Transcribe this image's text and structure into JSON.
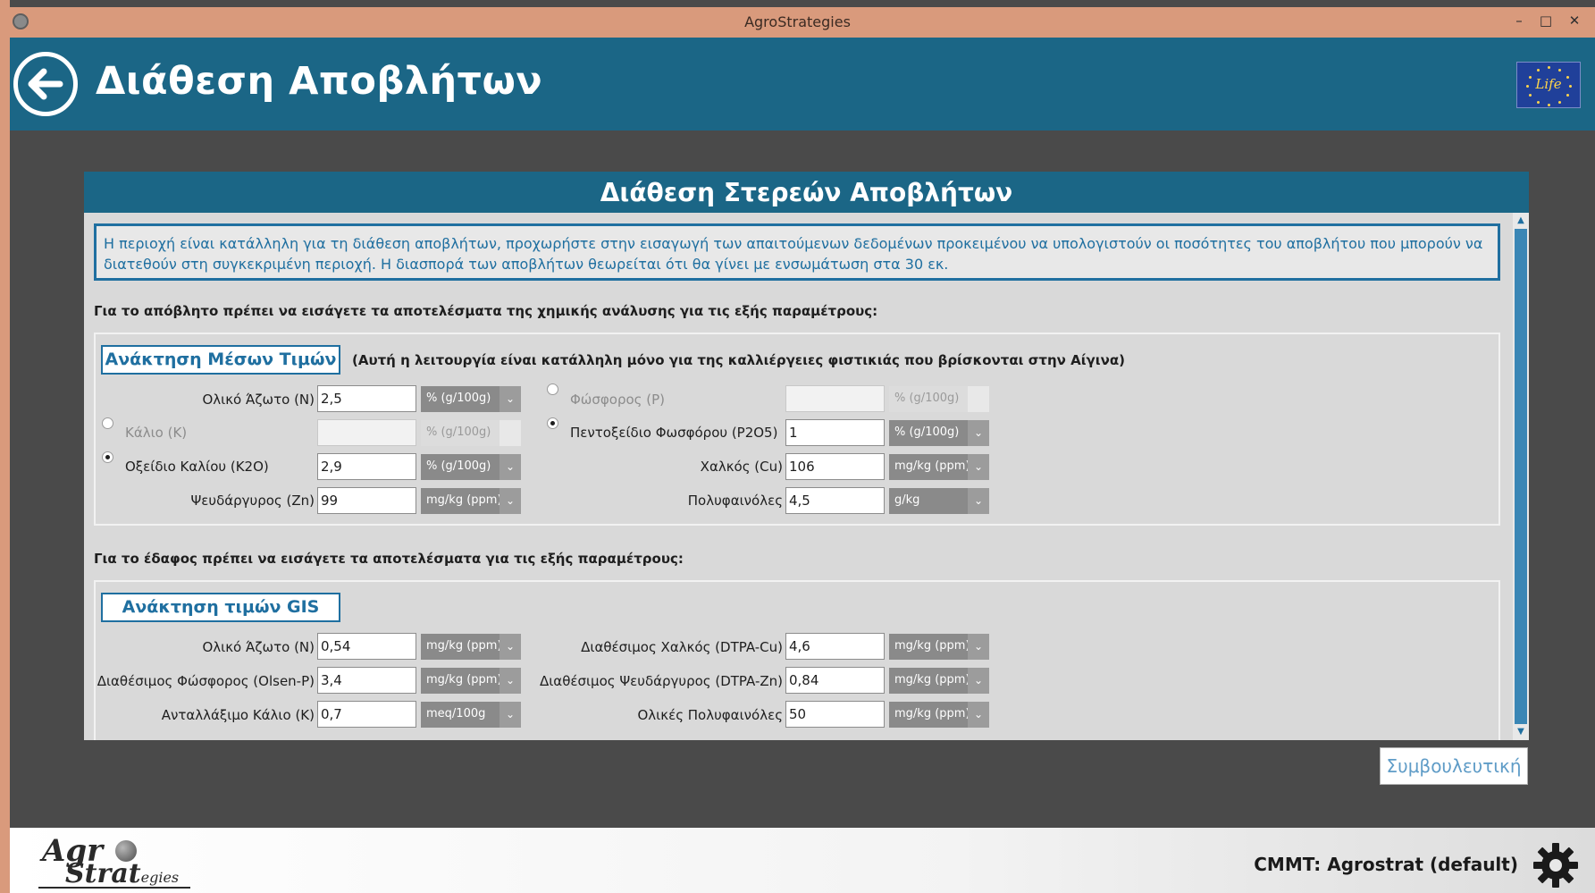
{
  "window": {
    "title": "AgroStrategies",
    "min_label": "–",
    "max_label": "□",
    "close_label": "✕"
  },
  "header": {
    "title": "Διάθεση Αποβλήτων",
    "eu_logo_text": "Life"
  },
  "card": {
    "title": "Διάθεση Στερεών Αποβλήτων",
    "info": "Η περιοχή είναι κατάλληλη για τη διάθεση αποβλήτων, προχωρήστε στην εισαγωγή των απαιτούμενων δεδομένων προκειμένου να υπολογιστούν οι ποσότητες του αποβλήτου που μπορούν να διατεθούν στη συγκεκριμένη περιοχή. Η διασπορά των αποβλήτων θεωρείται ότι θα γίνει με ενσωμάτωση στα 30 εκ.",
    "waste_section_label": "Για το απόβλητο πρέπει να εισάγετε τα αποτελέσματα της χημικής ανάλυσης για τις εξής παραμέτρους:",
    "soil_section_label": "Για το έδαφος πρέπει να εισάγετε τα αποτελέσματα για τις εξής παραμέτρους:"
  },
  "waste": {
    "fetch_button": "Ανάκτηση Μέσων Τιμών",
    "note": "(Αυτή η λειτουργία είναι κατάλληλη μόνο για της καλλιέργειες φιστικιάς που βρίσκονται στην Αίγινα)",
    "total_n": {
      "label": "Ολικό Άζωτο (N)",
      "value": "2,5",
      "unit": "% (g/100g)"
    },
    "potassium": {
      "label": "Κάλιο (K)",
      "value": "",
      "unit": "% (g/100g)",
      "selected": false
    },
    "k2o": {
      "label": "Οξείδιο Καλίου (K2O)",
      "value": "2,9",
      "unit": "% (g/100g)",
      "selected": true
    },
    "zinc": {
      "label": "Ψευδάργυρος (Zn)",
      "value": "99",
      "unit": "mg/kg (ppm)"
    },
    "phosphorus": {
      "label": "Φώσφορος (P)",
      "value": "",
      "unit": "% (g/100g)",
      "selected": false
    },
    "p2o5": {
      "label": "Πεντοξείδιο Φωσφόρου (P2O5)",
      "value": "1",
      "unit": "% (g/100g)",
      "selected": true
    },
    "copper": {
      "label": "Χαλκός (Cu)",
      "value": "106",
      "unit": "mg/kg (ppm)"
    },
    "polyphenols": {
      "label": "Πολυφαινόλες",
      "value": "4,5",
      "unit": "g/kg"
    }
  },
  "soil": {
    "fetch_button": "Ανάκτηση τιμών GIS",
    "total_n": {
      "label": "Ολικό Άζωτο (N)",
      "value": "0,54",
      "unit": "mg/kg (ppm)"
    },
    "olsen_p": {
      "label": "Διαθέσιμος Φώσφορος (Olsen-P)",
      "value": "3,4",
      "unit": "mg/kg (ppm)"
    },
    "exch_k": {
      "label": "Ανταλλάξιμο Κάλιο (K)",
      "value": "0,7",
      "unit": "meq/100g"
    },
    "dtpa_cu": {
      "label": "Διαθέσιμος Χαλκός (DTPA-Cu)",
      "value": "4,6",
      "unit": "mg/kg (ppm)"
    },
    "dtpa_zn": {
      "label": "Διαθέσιμος Ψευδάργυρος (DTPA-Zn)",
      "value": "0,84",
      "unit": "mg/kg (ppm)"
    },
    "total_polyphenols": {
      "label": "Ολικές Πολυφαινόλες",
      "value": "50",
      "unit": "mg/kg (ppm)"
    }
  },
  "advisory_button": "Συμβουλευτική",
  "footer": {
    "logo_line1": "Agr",
    "logo_line2": "Strat",
    "logo_line2_suffix": "egies",
    "cmmt": "CMMT: Agrostrat (default)"
  },
  "colors": {
    "header_bg": "#1b6686",
    "accent": "#1f6fa0",
    "titlebar": "#d99a7c",
    "work_bg": "#4a4a4a"
  }
}
